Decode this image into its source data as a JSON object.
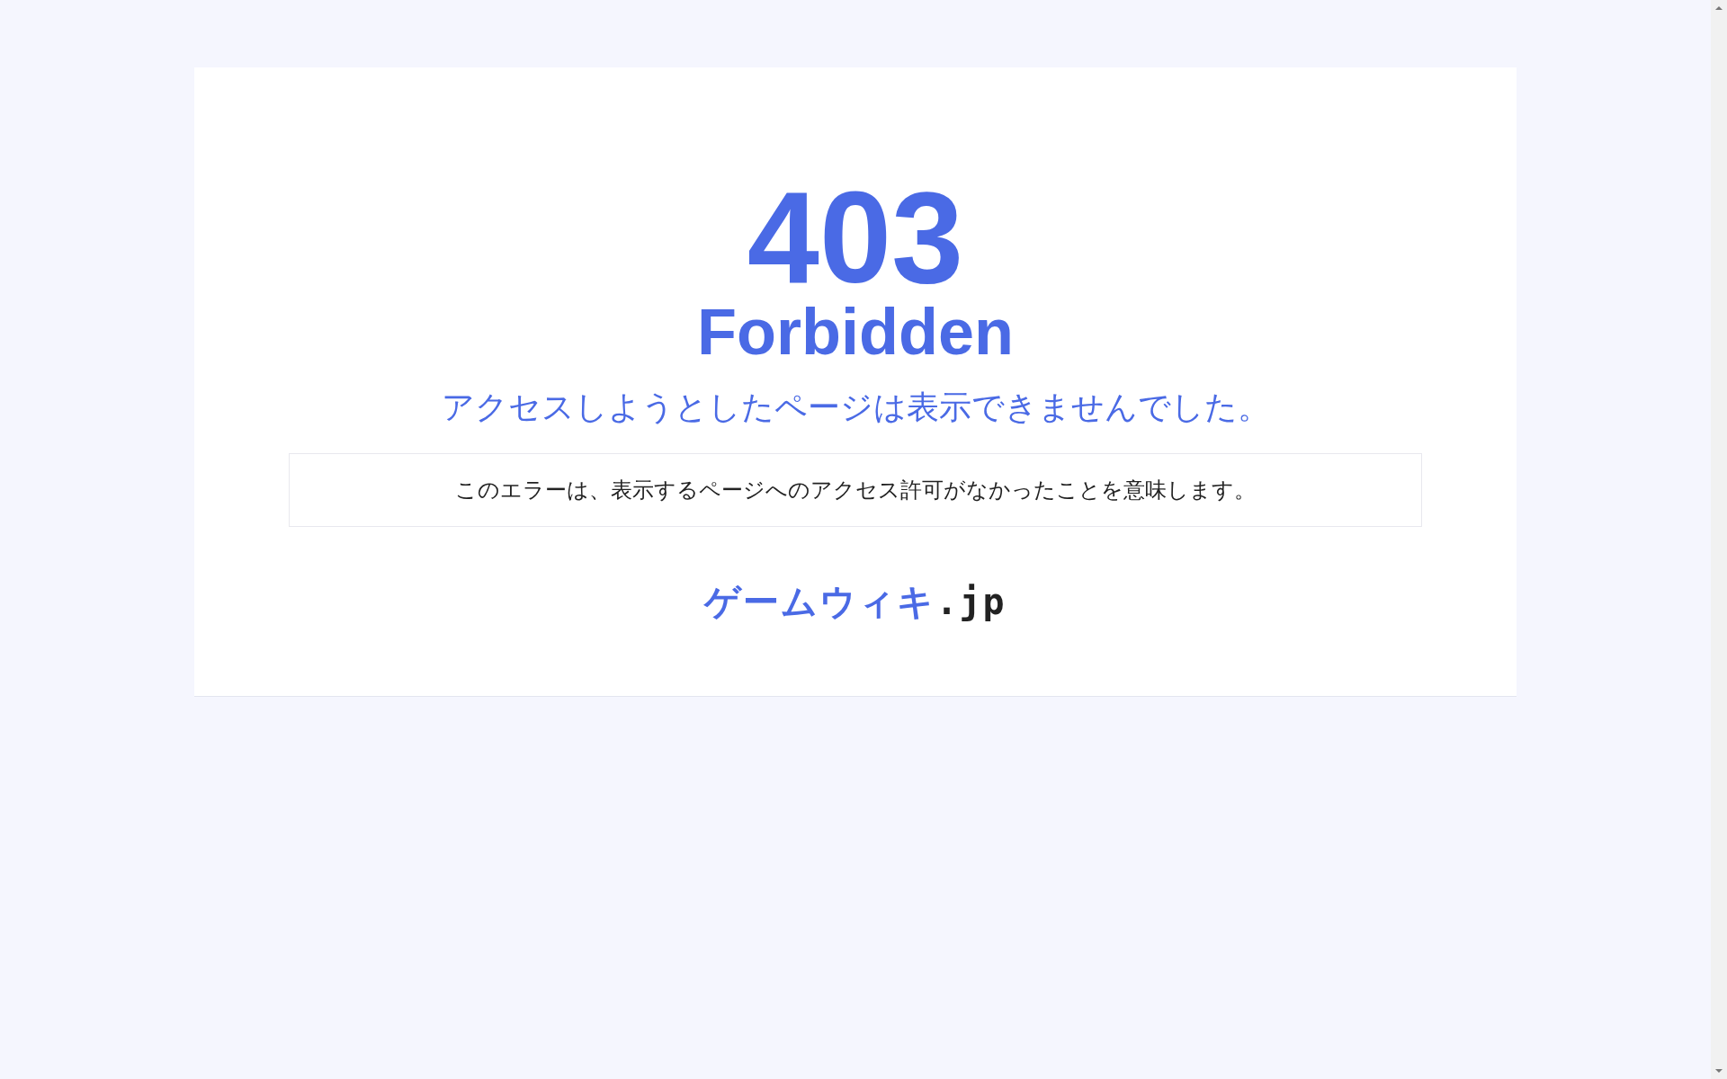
{
  "error": {
    "code": "403",
    "title": "Forbidden",
    "message": "アクセスしようとしたページは表示できませんでした。",
    "detail": "このエラーは、表示するページへのアクセス許可がなかったことを意味します。"
  },
  "logo": {
    "text": "ゲームウィキ",
    "suffix": ".jp"
  }
}
